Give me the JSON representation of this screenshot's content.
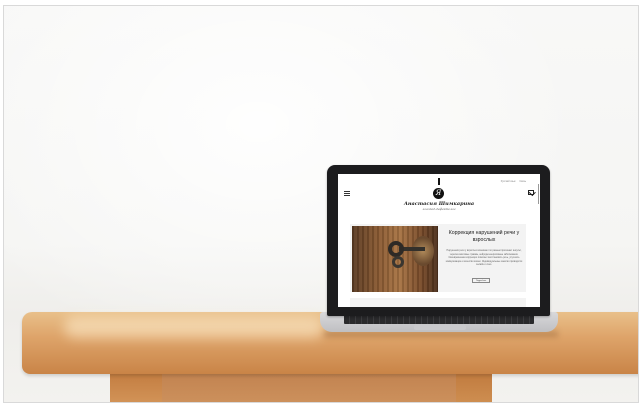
{
  "scene": {
    "description_tag": "laptop-mockup-on-wooden-table",
    "colors": {
      "wall": "#f5f5f3",
      "table": "#dea46a",
      "laptop_frame": "#1c1c1e",
      "screen_bg": "#ffffff"
    }
  },
  "website": {
    "topnav": [
      "Русский язык",
      "Связь"
    ],
    "logo_letter": "Я",
    "name": "Анастасия Шимкарина",
    "tagline": "логопед-дефектолог",
    "card": {
      "title": "Коррекция нарушений речи у взрослых",
      "text": "Нарушения речи у взрослых возникают по разным причинам: инсульт, черепно-мозговые травмы, нейродегенеративные заболевания. Своевременная коррекция помогает восстановить речь, улучшить коммуникацию и качество жизни. Индивидуальные занятия проводятся онлайн и очно.",
      "button": "Подробнее"
    },
    "icons": {
      "menu": "hamburger-menu-icon",
      "mail": "mail-icon"
    }
  }
}
